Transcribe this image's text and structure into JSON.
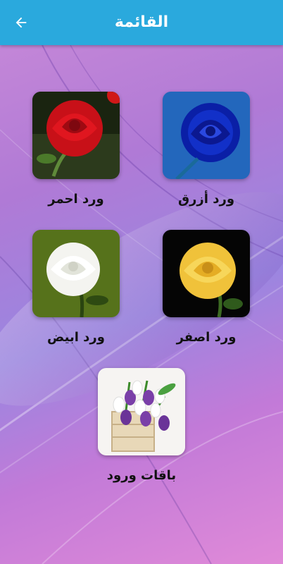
{
  "appbar": {
    "title": "القائمة",
    "back_icon": "arrow-left-icon",
    "color": "#2aa9dd"
  },
  "items": [
    {
      "label": "ورد أزرق",
      "icon": "blue-rose-image"
    },
    {
      "label": "ورد احمر",
      "icon": "red-rose-image"
    },
    {
      "label": "ورد اصفر",
      "icon": "yellow-rose-image"
    },
    {
      "label": "ورد ابيض",
      "icon": "white-rose-image"
    },
    {
      "label": "باقات ورود",
      "icon": "tulip-bouquet-image"
    }
  ]
}
